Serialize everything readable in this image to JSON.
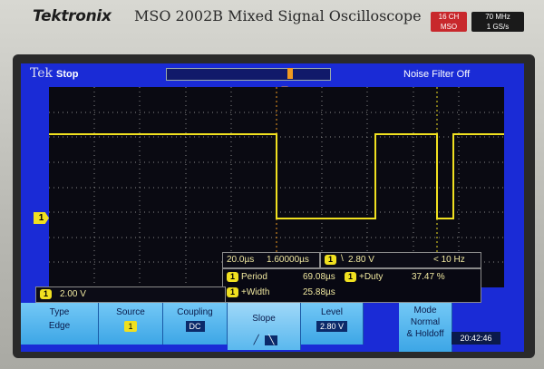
{
  "bezel": {
    "brand": "Tektronix",
    "model": "MSO 2002B Mixed Signal Oscilloscope",
    "badge_channels_1": "16 CH",
    "badge_channels_2": "MSO",
    "badge_spec_1": "70 MHz",
    "badge_spec_2": "1 GS/s"
  },
  "status": {
    "logo": "Tek",
    "run_state": "Stop",
    "noise_filter": "Noise Filter Off"
  },
  "trigger_markers": {
    "top": "T"
  },
  "channel1": {
    "marker": "1",
    "color": "#f0e020",
    "scale": "2.00 V"
  },
  "horizontal": {
    "timebase": "20.0µs",
    "position": "1.60000µs"
  },
  "trigger_readout": {
    "channel": "1",
    "level": "2.80 V",
    "freq": "< 10 Hz"
  },
  "measurements": [
    {
      "channel": "1",
      "name": "Period",
      "value": "69.08µs"
    },
    {
      "channel": "1",
      "name": "+Width",
      "value": "25.88µs"
    },
    {
      "channel": "1",
      "name": "+Duty",
      "value": "37.47 %"
    }
  ],
  "menu": {
    "type": {
      "label": "Type",
      "value": "Edge"
    },
    "source": {
      "label": "Source",
      "value": "1"
    },
    "coupling": {
      "label": "Coupling",
      "value": "DC"
    },
    "slope": {
      "label": "Slope"
    },
    "level": {
      "label": "Level",
      "value": "2.80 V"
    },
    "mode": {
      "label": "Mode",
      "value_1": "Normal",
      "value_2": "& Holdoff"
    }
  },
  "clock": "20:42:46",
  "colors": {
    "screen": "#1a2bd6",
    "trace": "#f0e020",
    "menu": "#3da6e6",
    "trigger": "#f09a20"
  }
}
